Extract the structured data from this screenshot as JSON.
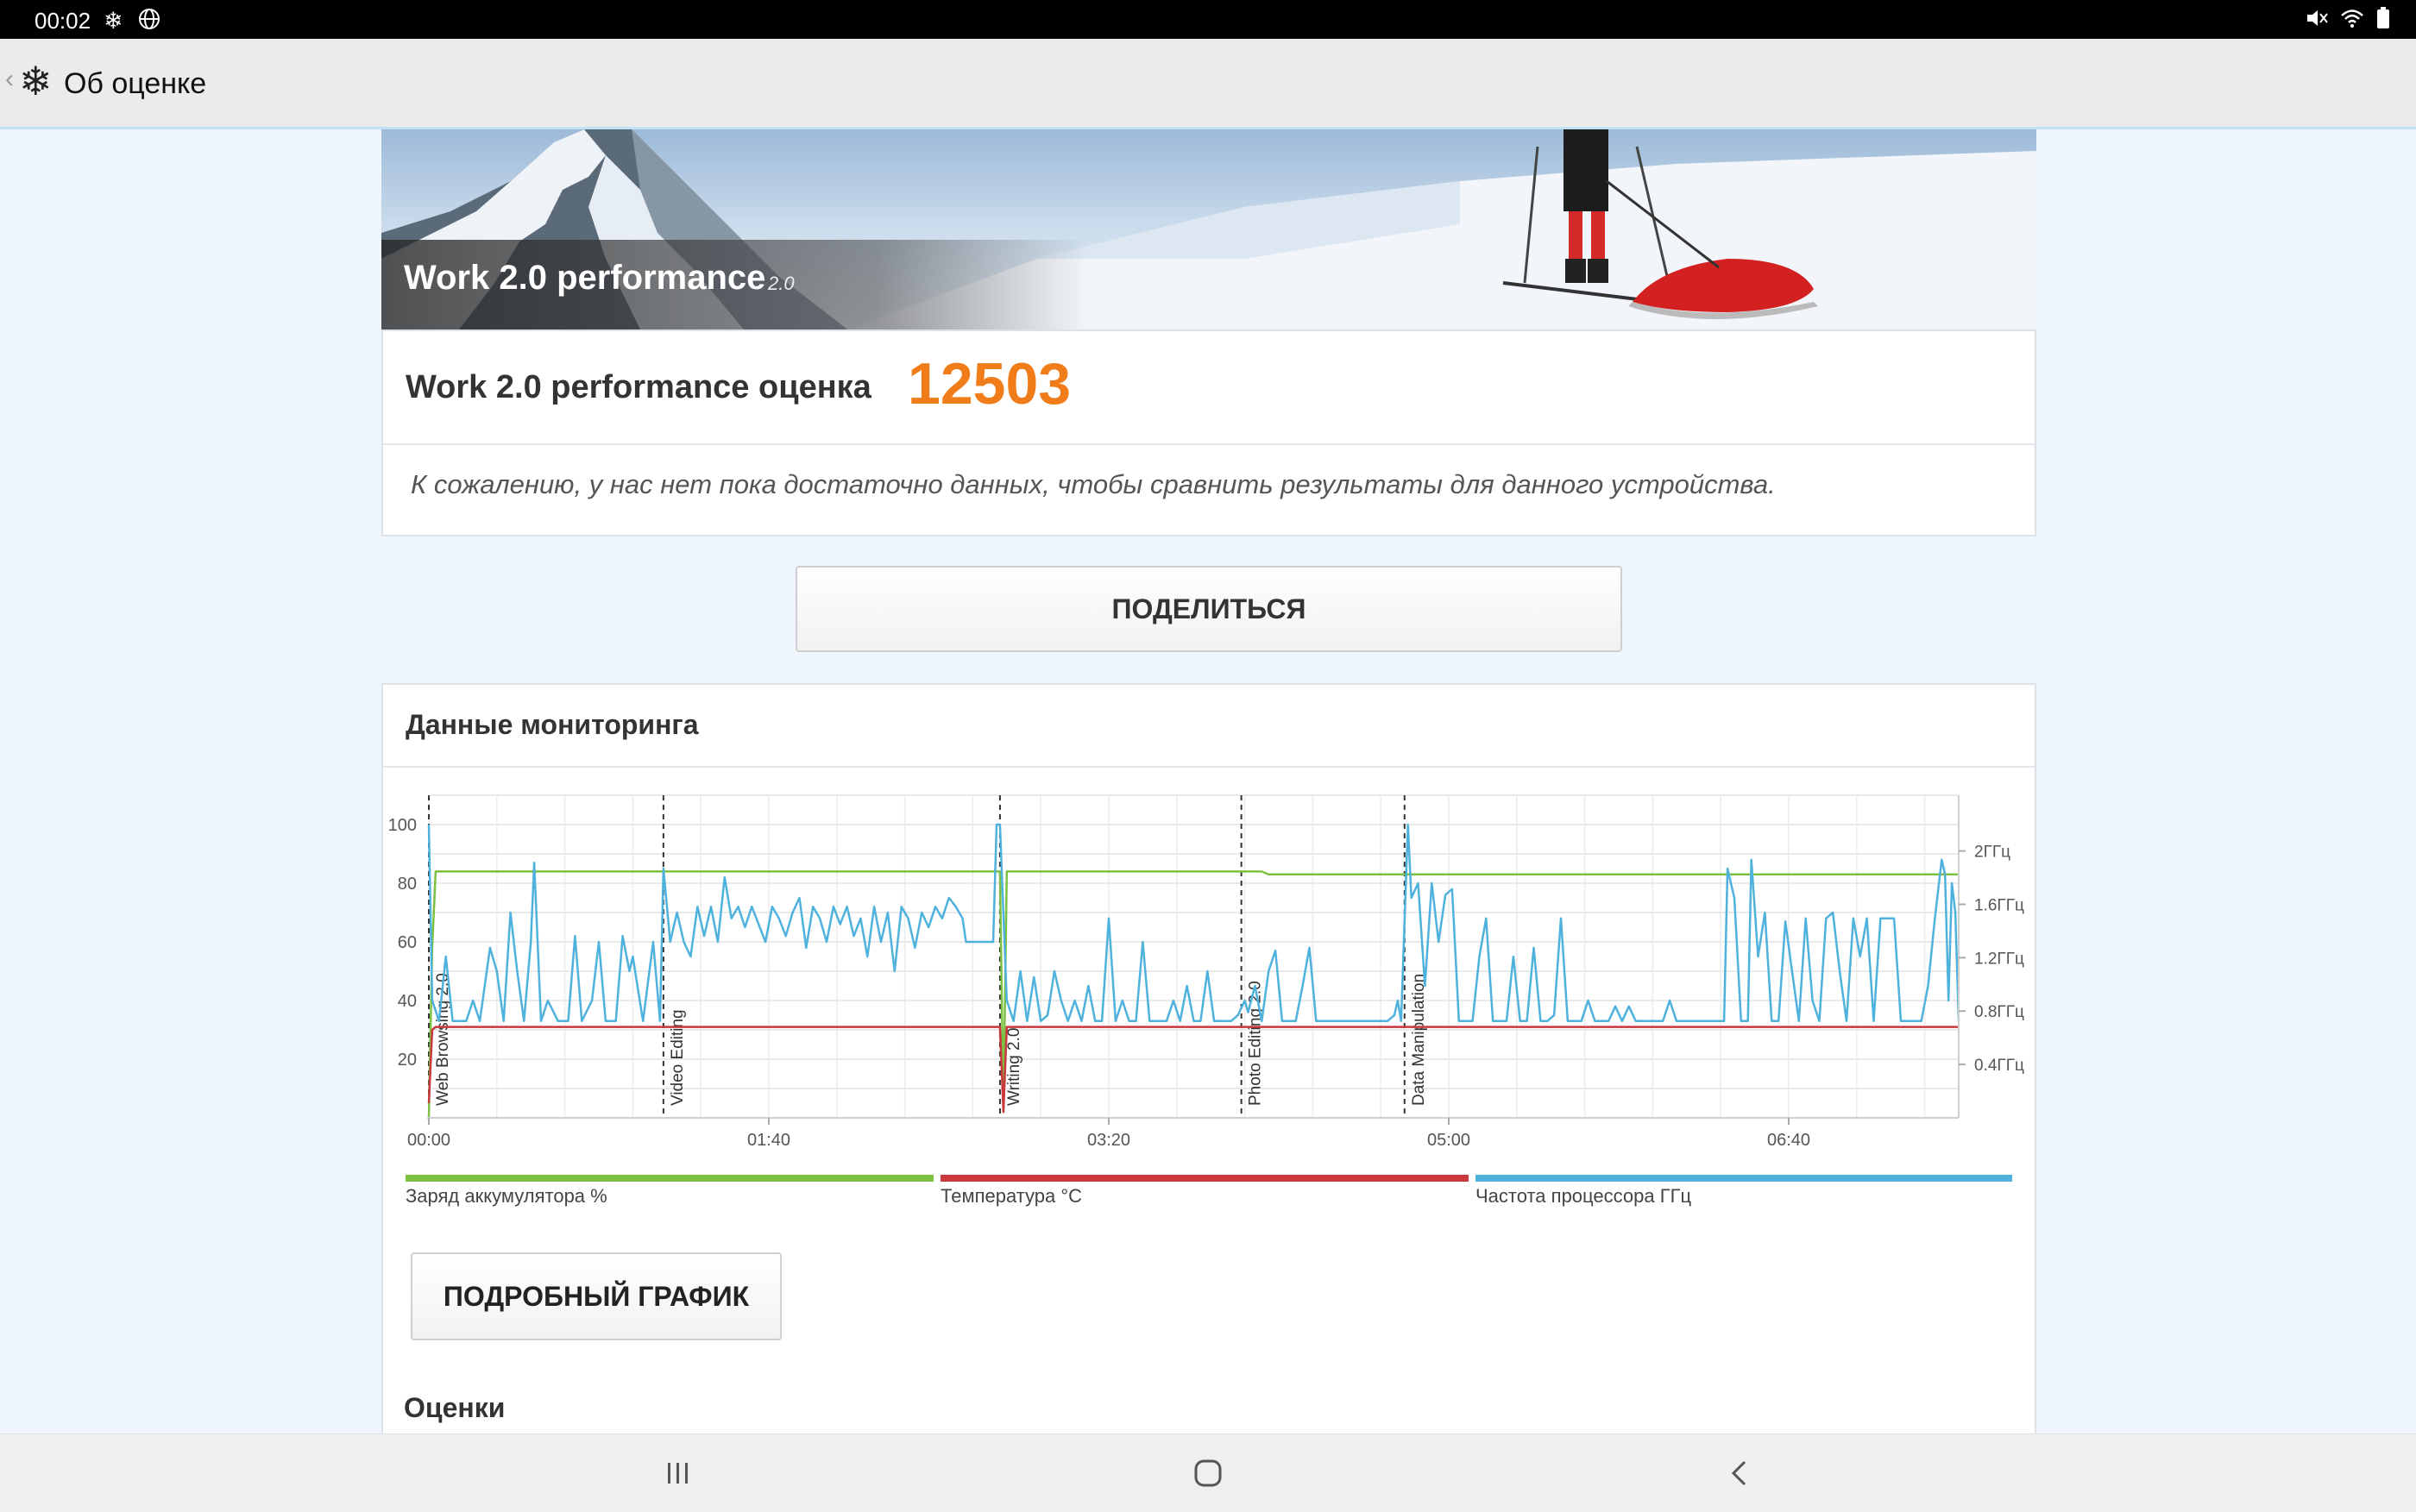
{
  "status_bar": {
    "time": "00:02",
    "icons": [
      "snowflake-icon",
      "globe-icon",
      "mute-icon",
      "wifi-icon",
      "battery-icon"
    ]
  },
  "app_bar": {
    "title": "Об оценке",
    "icon": "snowflake-icon"
  },
  "hero": {
    "title": "Work 2.0 performance",
    "version": "2.0"
  },
  "score": {
    "label": "Work 2.0 performance оценка",
    "value": "12503",
    "note": "К сожалению, у нас нет пока достаточно данных, чтобы сравнить результаты для данного устройства.",
    "accent_color": "#f07d1a"
  },
  "share_button": {
    "label": "ПОДЕЛИТЬСЯ"
  },
  "monitoring": {
    "title": "Данные мониторинга",
    "detail_button": "ПОДРОБНЫЙ ГРАФИК",
    "scores_heading": "Оценки"
  },
  "chart_data": {
    "type": "line",
    "x_range": [
      0,
      450
    ],
    "x_ticks": [
      {
        "t": 0,
        "label": "00:00"
      },
      {
        "t": 100,
        "label": "01:40"
      },
      {
        "t": 200,
        "label": "03:20"
      },
      {
        "t": 300,
        "label": "05:00"
      },
      {
        "t": 400,
        "label": "06:40"
      }
    ],
    "left_axis": {
      "ylim": [
        0,
        100
      ],
      "ticks": [
        20,
        40,
        60,
        80,
        100
      ]
    },
    "right_axis": {
      "ticks": [
        {
          "value": 0.4,
          "label": "0.4ГГц"
        },
        {
          "value": 0.8,
          "label": "0.8ГГц"
        },
        {
          "value": 1.2,
          "label": "1.2ГГц"
        },
        {
          "value": 1.6,
          "label": "1.6ГГц"
        },
        {
          "value": 2.0,
          "label": "2ГГц"
        }
      ]
    },
    "markers": [
      {
        "t": 0,
        "label": "Web Browsing 2.0"
      },
      {
        "t": 69,
        "label": "Video Editing"
      },
      {
        "t": 168,
        "label": "Writing 2.0"
      },
      {
        "t": 239,
        "label": "Photo Editing 2.0"
      },
      {
        "t": 287,
        "label": "Data Manipulation"
      }
    ],
    "series": [
      {
        "name": "Заряд аккумулятора %",
        "color": "#7cc142",
        "points": [
          [
            0,
            0
          ],
          [
            1,
            58
          ],
          [
            2,
            84
          ],
          [
            3,
            84
          ],
          [
            168,
            84
          ],
          [
            169,
            2
          ],
          [
            170,
            84
          ],
          [
            239,
            84
          ],
          [
            245,
            84
          ],
          [
            247,
            83
          ],
          [
            450,
            83
          ]
        ]
      },
      {
        "name": "Температура °C",
        "color": "#c8383c",
        "points": [
          [
            0,
            5
          ],
          [
            1,
            30
          ],
          [
            2,
            31
          ],
          [
            168,
            31
          ],
          [
            169,
            2
          ],
          [
            170,
            31
          ],
          [
            450,
            31
          ]
        ]
      },
      {
        "name": "Частота процессора ГГц",
        "color": "#4fb2dd",
        "points": [
          [
            0,
            100
          ],
          [
            1,
            40
          ],
          [
            3,
            33
          ],
          [
            5,
            55
          ],
          [
            7,
            33
          ],
          [
            11,
            33
          ],
          [
            13,
            40
          ],
          [
            15,
            33
          ],
          [
            18,
            58
          ],
          [
            20,
            50
          ],
          [
            22,
            33
          ],
          [
            24,
            70
          ],
          [
            26,
            50
          ],
          [
            28,
            33
          ],
          [
            30,
            60
          ],
          [
            31,
            87
          ],
          [
            33,
            33
          ],
          [
            35,
            40
          ],
          [
            38,
            33
          ],
          [
            41,
            33
          ],
          [
            43,
            62
          ],
          [
            45,
            33
          ],
          [
            48,
            40
          ],
          [
            50,
            60
          ],
          [
            52,
            33
          ],
          [
            55,
            33
          ],
          [
            57,
            62
          ],
          [
            59,
            50
          ],
          [
            60,
            55
          ],
          [
            63,
            33
          ],
          [
            66,
            60
          ],
          [
            68,
            33
          ],
          [
            69,
            85
          ],
          [
            71,
            60
          ],
          [
            73,
            70
          ],
          [
            75,
            60
          ],
          [
            77,
            55
          ],
          [
            79,
            72
          ],
          [
            81,
            62
          ],
          [
            83,
            72
          ],
          [
            85,
            60
          ],
          [
            87,
            82
          ],
          [
            89,
            68
          ],
          [
            91,
            72
          ],
          [
            93,
            65
          ],
          [
            95,
            72
          ],
          [
            97,
            66
          ],
          [
            99,
            60
          ],
          [
            101,
            72
          ],
          [
            103,
            68
          ],
          [
            105,
            62
          ],
          [
            107,
            70
          ],
          [
            109,
            75
          ],
          [
            111,
            58
          ],
          [
            113,
            72
          ],
          [
            115,
            68
          ],
          [
            117,
            60
          ],
          [
            119,
            72
          ],
          [
            121,
            66
          ],
          [
            123,
            72
          ],
          [
            125,
            62
          ],
          [
            127,
            68
          ],
          [
            129,
            55
          ],
          [
            131,
            72
          ],
          [
            133,
            60
          ],
          [
            135,
            70
          ],
          [
            137,
            50
          ],
          [
            139,
            72
          ],
          [
            141,
            68
          ],
          [
            143,
            58
          ],
          [
            145,
            70
          ],
          [
            147,
            65
          ],
          [
            149,
            72
          ],
          [
            151,
            68
          ],
          [
            153,
            75
          ],
          [
            155,
            72
          ],
          [
            157,
            68
          ],
          [
            158,
            60
          ],
          [
            160,
            60
          ],
          [
            163,
            60
          ],
          [
            166,
            60
          ],
          [
            167,
            100
          ],
          [
            168,
            100
          ],
          [
            170,
            40
          ],
          [
            172,
            33
          ],
          [
            174,
            50
          ],
          [
            176,
            33
          ],
          [
            178,
            48
          ],
          [
            180,
            33
          ],
          [
            182,
            35
          ],
          [
            184,
            50
          ],
          [
            186,
            40
          ],
          [
            188,
            33
          ],
          [
            190,
            40
          ],
          [
            192,
            33
          ],
          [
            194,
            45
          ],
          [
            196,
            33
          ],
          [
            198,
            33
          ],
          [
            200,
            68
          ],
          [
            202,
            33
          ],
          [
            204,
            40
          ],
          [
            206,
            33
          ],
          [
            208,
            33
          ],
          [
            210,
            60
          ],
          [
            212,
            33
          ],
          [
            214,
            33
          ],
          [
            217,
            33
          ],
          [
            219,
            40
          ],
          [
            221,
            33
          ],
          [
            223,
            45
          ],
          [
            225,
            33
          ],
          [
            227,
            33
          ],
          [
            229,
            50
          ],
          [
            231,
            33
          ],
          [
            233,
            33
          ],
          [
            236,
            33
          ],
          [
            238,
            35
          ],
          [
            240,
            40
          ],
          [
            241,
            36
          ],
          [
            243,
            45
          ],
          [
            245,
            33
          ],
          [
            247,
            50
          ],
          [
            249,
            57
          ],
          [
            251,
            33
          ],
          [
            253,
            33
          ],
          [
            255,
            33
          ],
          [
            257,
            45
          ],
          [
            259,
            58
          ],
          [
            261,
            33
          ],
          [
            264,
            33
          ],
          [
            267,
            33
          ],
          [
            270,
            33
          ],
          [
            273,
            33
          ],
          [
            276,
            33
          ],
          [
            279,
            33
          ],
          [
            282,
            33
          ],
          [
            284,
            35
          ],
          [
            285,
            40
          ],
          [
            286,
            33
          ],
          [
            288,
            100
          ],
          [
            289,
            75
          ],
          [
            291,
            80
          ],
          [
            293,
            45
          ],
          [
            295,
            80
          ],
          [
            297,
            60
          ],
          [
            299,
            76
          ],
          [
            301,
            78
          ],
          [
            303,
            33
          ],
          [
            305,
            33
          ],
          [
            307,
            33
          ],
          [
            309,
            55
          ],
          [
            311,
            68
          ],
          [
            313,
            33
          ],
          [
            315,
            33
          ],
          [
            317,
            33
          ],
          [
            319,
            55
          ],
          [
            321,
            33
          ],
          [
            323,
            33
          ],
          [
            325,
            58
          ],
          [
            327,
            33
          ],
          [
            329,
            33
          ],
          [
            331,
            35
          ],
          [
            333,
            68
          ],
          [
            335,
            33
          ],
          [
            337,
            33
          ],
          [
            339,
            33
          ],
          [
            341,
            40
          ],
          [
            343,
            33
          ],
          [
            345,
            33
          ],
          [
            347,
            33
          ],
          [
            349,
            38
          ],
          [
            351,
            33
          ],
          [
            353,
            38
          ],
          [
            355,
            33
          ],
          [
            357,
            33
          ],
          [
            359,
            33
          ],
          [
            361,
            33
          ],
          [
            363,
            33
          ],
          [
            365,
            40
          ],
          [
            367,
            33
          ],
          [
            369,
            33
          ],
          [
            371,
            33
          ],
          [
            373,
            33
          ],
          [
            375,
            33
          ],
          [
            377,
            33
          ],
          [
            379,
            33
          ],
          [
            381,
            33
          ],
          [
            382,
            85
          ],
          [
            384,
            75
          ],
          [
            386,
            33
          ],
          [
            388,
            33
          ],
          [
            389,
            88
          ],
          [
            391,
            55
          ],
          [
            393,
            70
          ],
          [
            395,
            33
          ],
          [
            397,
            33
          ],
          [
            399,
            67
          ],
          [
            401,
            50
          ],
          [
            403,
            33
          ],
          [
            405,
            68
          ],
          [
            407,
            40
          ],
          [
            409,
            33
          ],
          [
            411,
            68
          ],
          [
            413,
            70
          ],
          [
            415,
            50
          ],
          [
            417,
            33
          ],
          [
            419,
            68
          ],
          [
            421,
            55
          ],
          [
            423,
            68
          ],
          [
            425,
            33
          ],
          [
            427,
            68
          ],
          [
            429,
            68
          ],
          [
            431,
            68
          ],
          [
            433,
            33
          ],
          [
            435,
            33
          ],
          [
            437,
            33
          ],
          [
            439,
            33
          ],
          [
            441,
            45
          ],
          [
            443,
            68
          ],
          [
            445,
            88
          ],
          [
            446,
            83
          ],
          [
            447,
            40
          ],
          [
            448,
            80
          ],
          [
            449,
            70
          ],
          [
            450,
            33
          ]
        ]
      }
    ]
  },
  "nav_bar": {
    "icons": [
      "recents-icon",
      "home-icon",
      "back-icon"
    ]
  }
}
